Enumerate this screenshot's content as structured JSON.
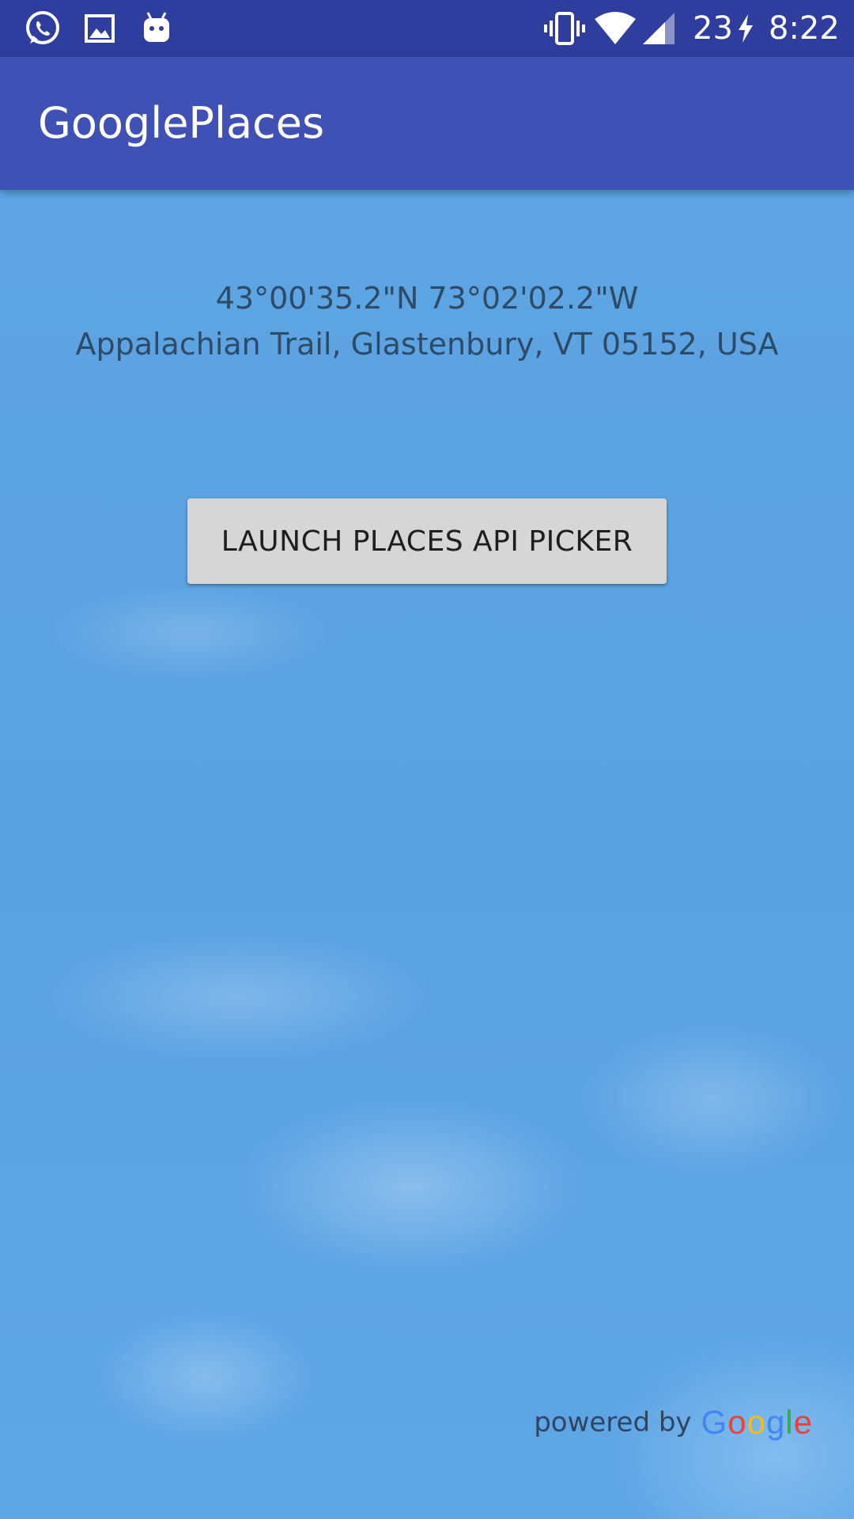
{
  "status_bar": {
    "icons_left": [
      "whatsapp-icon",
      "image-icon",
      "android-icon"
    ],
    "icons_right": [
      "vibrate-icon",
      "wifi-icon",
      "signal-icon",
      "charging-bolt-icon"
    ],
    "battery_level": "23",
    "time": "8:22"
  },
  "app_bar": {
    "title": "GooglePlaces",
    "color": "#3f51b5"
  },
  "location": {
    "coordinates": "43°00'35.2\"N 73°02'02.2\"W",
    "address": "Appalachian Trail, Glastenbury, VT 05152, USA"
  },
  "actions": {
    "launch_label": "LAUNCH PLACES API PICKER"
  },
  "attribution": {
    "powered_by": "powered by",
    "logo_letters": [
      {
        "char": "G",
        "color": "#4285f4"
      },
      {
        "char": "o",
        "color": "#ea4335"
      },
      {
        "char": "o",
        "color": "#fbbc05"
      },
      {
        "char": "g",
        "color": "#4285f4"
      },
      {
        "char": "l",
        "color": "#34a853"
      },
      {
        "char": "e",
        "color": "#ea4335"
      }
    ]
  },
  "colors": {
    "status_bar": "#2f3d9e",
    "sky": "#5ba3e3",
    "button": "#d6d6d6"
  }
}
